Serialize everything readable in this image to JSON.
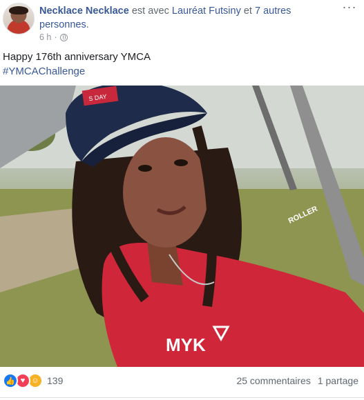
{
  "post": {
    "author": "Necklace Necklace",
    "with_text": " est avec ",
    "tagged_person": "Lauréat Futsiny",
    "and_text": " et ",
    "others_text": "7 autres personnes",
    "period": ".",
    "time": "6 h",
    "separator": "·",
    "more_label": "···",
    "text_line1": "Happy 176th anniversary YMCA",
    "hashtag": "#YMCAChallenge",
    "photo_icons": {
      "cap_badge": "S DAY",
      "shirt_logo": "MYK",
      "sleeve_text": "ROLLER"
    }
  },
  "footer": {
    "reaction_count": "139",
    "comments": "25 commentaires",
    "shares": "1 partage"
  },
  "icons": {
    "like": "👍",
    "love": "♥",
    "care": "☺"
  }
}
